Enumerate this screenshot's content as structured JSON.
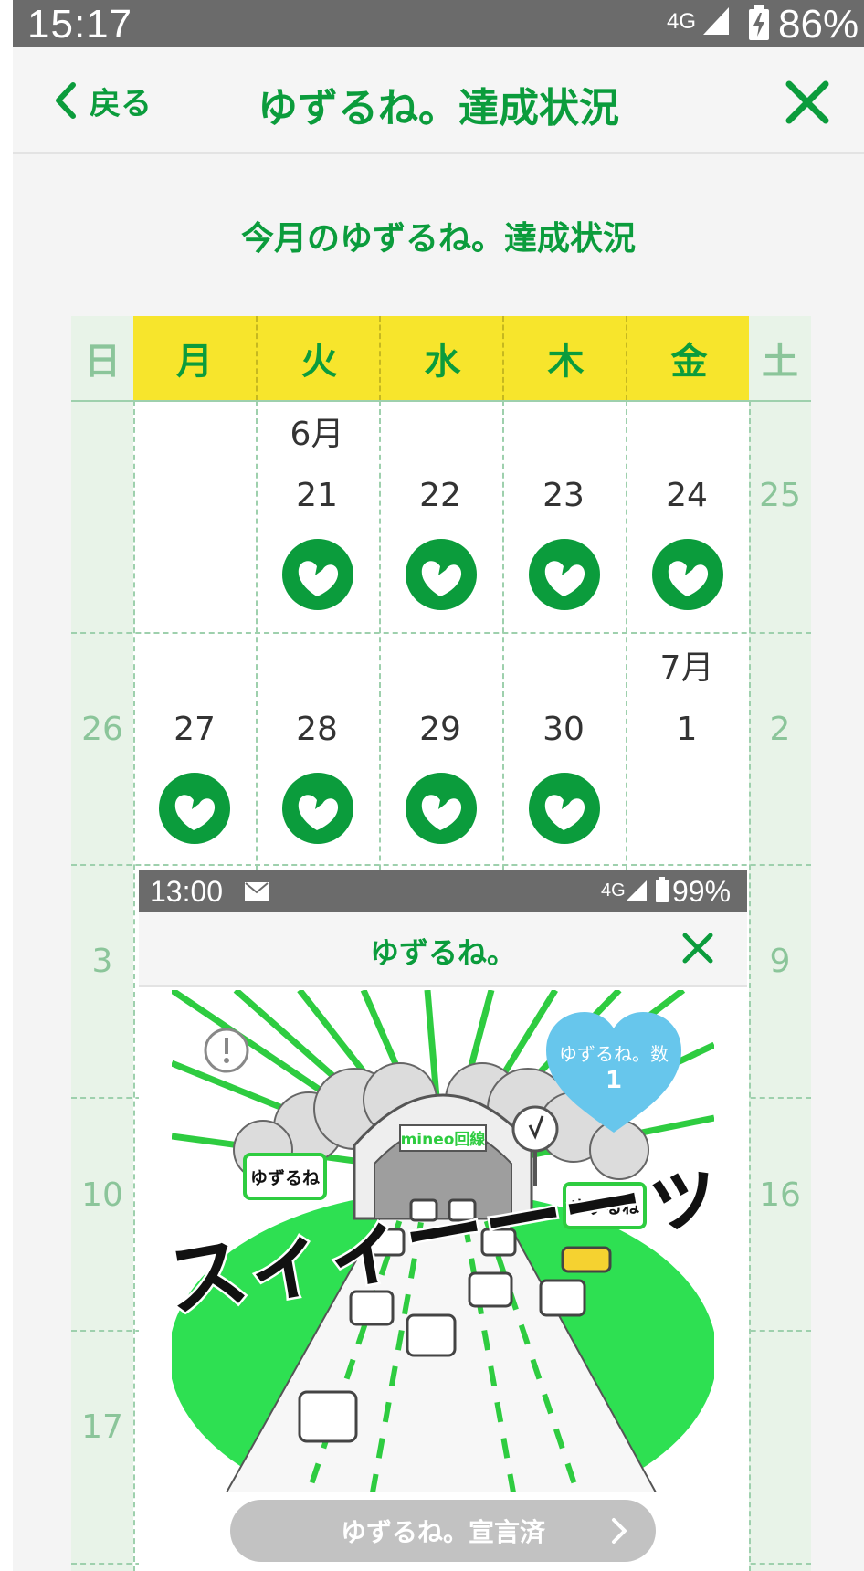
{
  "status_bar": {
    "time": "15:17",
    "network": "4G",
    "battery_percent": "86%"
  },
  "header": {
    "back_label": "戻る",
    "title": "ゆずるね。達成状況"
  },
  "subtitle": "今月のゆずるね。達成状況",
  "calendar": {
    "weekdays": [
      "日",
      "月",
      "火",
      "水",
      "木",
      "金",
      "土"
    ],
    "colors": {
      "weekday_header_bg": "#f7e52c",
      "weekend_bg": "#e8f3e8",
      "accent_green": "#0b9c3c",
      "weekend_text": "#8bc59a"
    },
    "months": {
      "june": "6月",
      "july": "7月"
    },
    "weeks": [
      [
        "",
        "",
        "21",
        "22",
        "23",
        "24",
        "25"
      ],
      [
        "26",
        "27",
        "28",
        "29",
        "30",
        "1",
        "2"
      ],
      [
        "3",
        "",
        "",
        "",
        "",
        "",
        "9"
      ],
      [
        "10",
        "",
        "",
        "",
        "",
        "",
        "16"
      ],
      [
        "17",
        "",
        "",
        "",
        "",
        "",
        ""
      ]
    ],
    "achieved": {
      "week1": [
        false,
        false,
        true,
        true,
        true,
        true,
        false
      ],
      "week2": [
        false,
        true,
        true,
        true,
        true,
        false,
        false
      ]
    }
  },
  "embedded_screenshot": {
    "time": "13:00",
    "network": "4G",
    "battery_percent": "99%",
    "title": "ゆずるね。",
    "bubble_label": "ゆずるね。数",
    "bubble_value": "1",
    "banner": "mineo回線",
    "sign_left": "ゆずるね",
    "sign_right": "ゆずるね",
    "sound_effect": "スィィーーーッ",
    "declare_button": "ゆずるね。宣言済"
  }
}
